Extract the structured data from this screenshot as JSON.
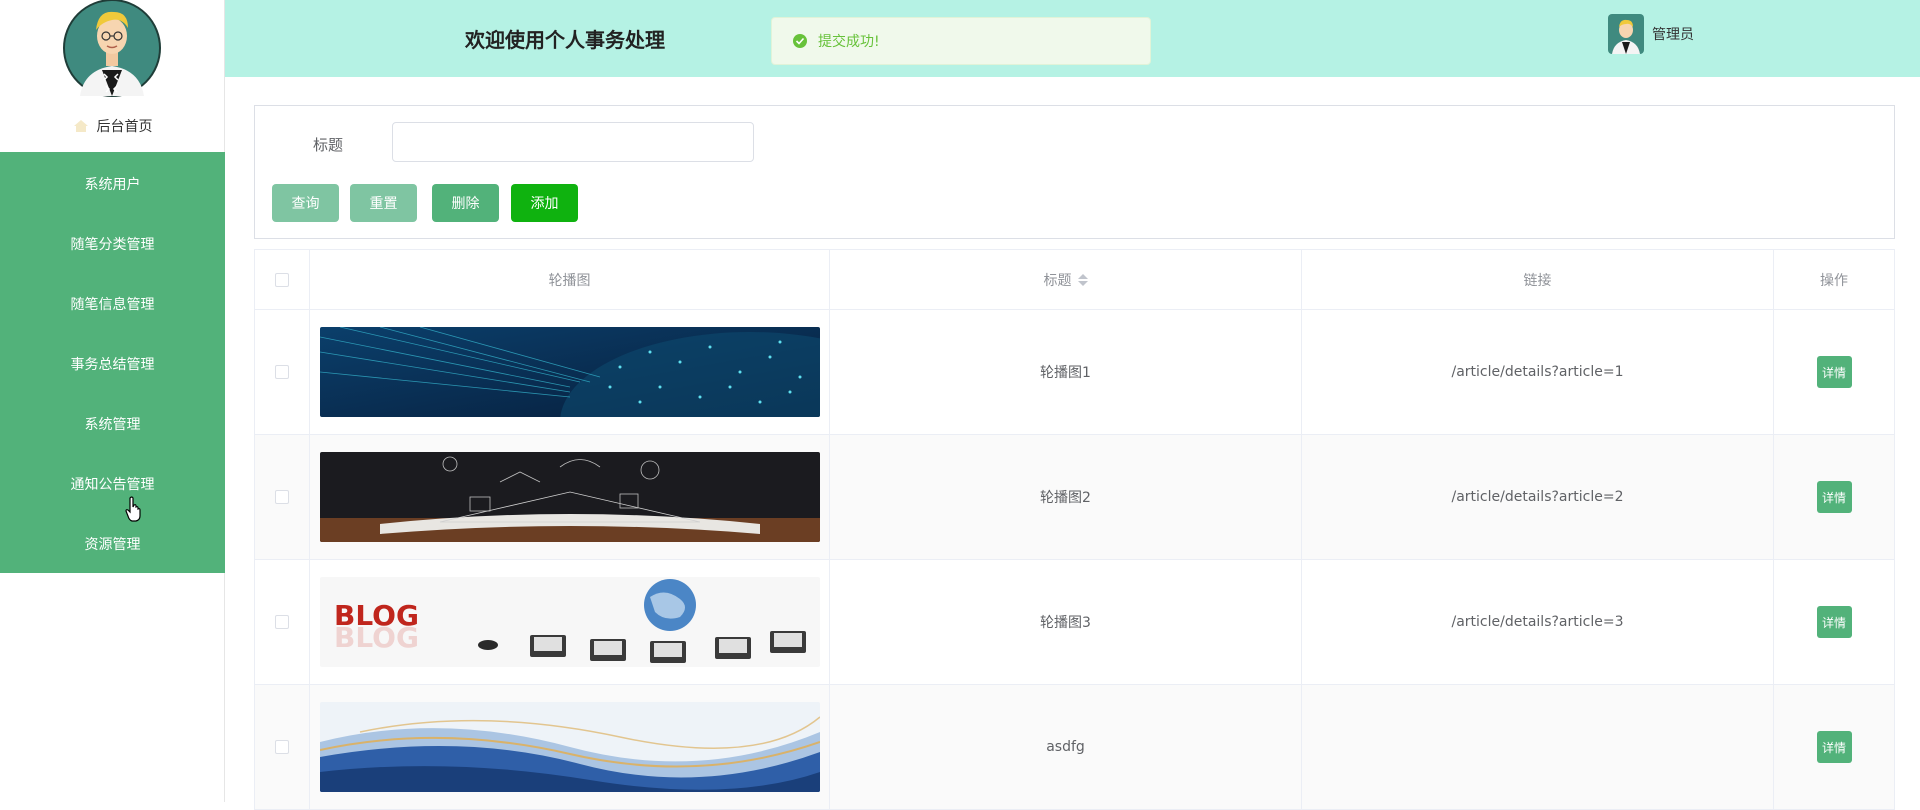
{
  "sidebar": {
    "home_label": "后台首页",
    "items": [
      {
        "label": "系统用户"
      },
      {
        "label": "随笔分类管理"
      },
      {
        "label": "随笔信息管理"
      },
      {
        "label": "事务总结管理"
      },
      {
        "label": "系统管理"
      },
      {
        "label": "通知公告管理"
      },
      {
        "label": "资源管理"
      }
    ]
  },
  "header": {
    "title": "欢迎使用个人事务处理",
    "toast": "提交成功!",
    "user_name": "管理员"
  },
  "search": {
    "label": "标题",
    "input_value": "",
    "buttons": {
      "query": "查询",
      "reset": "重置",
      "delete": "删除",
      "add": "添加"
    }
  },
  "table": {
    "columns": {
      "image": "轮播图",
      "title": "标题",
      "link": "链接",
      "action": "操作"
    },
    "rows": [
      {
        "title": "轮播图1",
        "link": "/article/details?article=1",
        "action": "详情",
        "image": "network-globe"
      },
      {
        "title": "轮播图2",
        "link": "/article/details?article=2",
        "action": "详情",
        "image": "open-book"
      },
      {
        "title": "轮播图3",
        "link": "/article/details?article=3",
        "action": "详情",
        "image": "blog-network"
      },
      {
        "title": "asdfg",
        "link": "",
        "action": "详情",
        "image": "marble-waves"
      }
    ]
  },
  "colors": {
    "accent": "#52b27a",
    "header_bg": "#b5f2e4",
    "add_button": "#0fb20f",
    "toast_text": "#67c23a"
  }
}
